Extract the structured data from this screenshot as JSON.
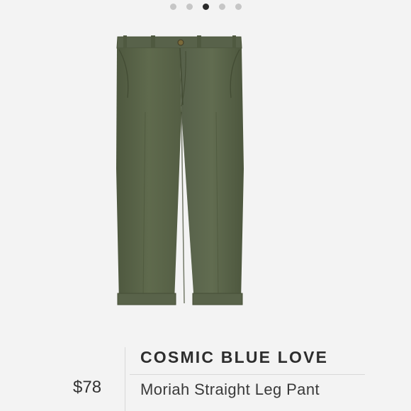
{
  "carousel": {
    "total": 5,
    "active_index": 2
  },
  "product": {
    "brand": "COSMIC BLUE LOVE",
    "name": "Moriah Straight Leg Pant",
    "price": "$78",
    "color": "#59634a"
  }
}
